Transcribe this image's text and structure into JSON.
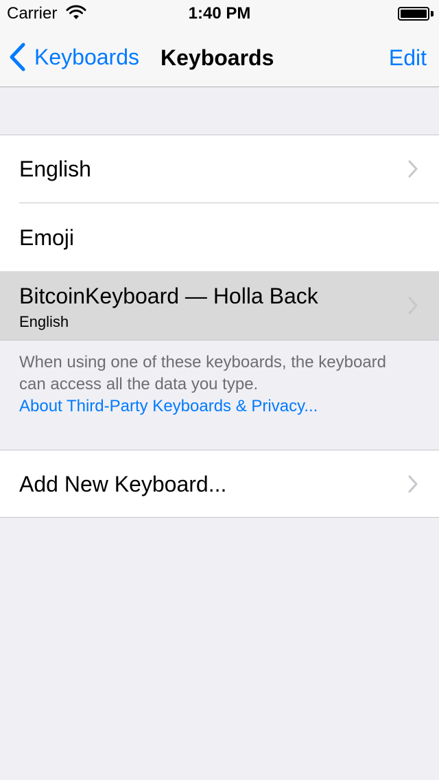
{
  "status_bar": {
    "carrier": "Carrier",
    "time": "1:40 PM",
    "wifi_icon": "wifi-icon",
    "battery_icon": "battery-icon"
  },
  "nav": {
    "back_label": "Keyboards",
    "back_icon": "chevron-left-icon",
    "title": "Keyboards",
    "edit_label": "Edit"
  },
  "keyboards": [
    {
      "label": "English",
      "has_chevron": true
    },
    {
      "label": "Emoji",
      "has_chevron": false
    },
    {
      "label": "BitcoinKeyboard — Holla Back",
      "sublabel": "English",
      "has_chevron": true,
      "highlighted": true
    }
  ],
  "footer": {
    "text": "When using one of these keyboards, the keyboard can access all the data you type.",
    "link": "About Third-Party Keyboards & Privacy..."
  },
  "add_keyboard": {
    "label": "Add New Keyboard..."
  },
  "colors": {
    "accent": "#007aff",
    "background": "#efeff4",
    "highlight": "#d9d9d9",
    "footer_text": "#6d6d72",
    "separator": "#c8c7cc"
  }
}
